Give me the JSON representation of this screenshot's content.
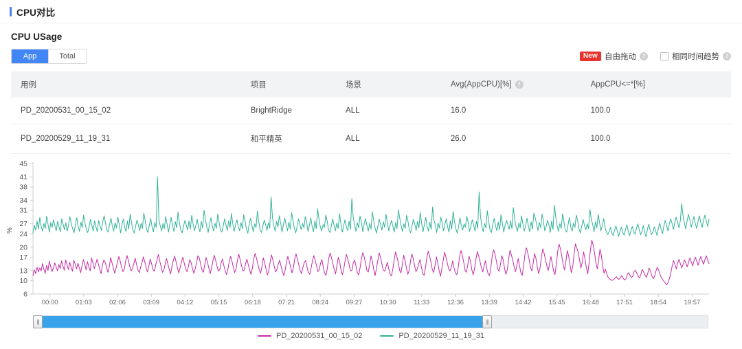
{
  "panel": {
    "title": "CPU对比"
  },
  "section": {
    "title": "CPU USage"
  },
  "tabs": [
    {
      "label": "App",
      "active": true
    },
    {
      "label": "Total",
      "active": false
    }
  ],
  "toolbar": {
    "new_badge": "New",
    "free_drag_label": "自由拖动",
    "free_drag_help": "?",
    "same_time_trend_label": "相同时间趋势",
    "same_time_trend_help": "?",
    "same_time_trend_checked": false
  },
  "table": {
    "columns": [
      "用例",
      "项目",
      "场景",
      "Avg(AppCPU)[%]",
      "AppCPU<=*[%]"
    ],
    "column_help": [
      false,
      false,
      false,
      true,
      false
    ],
    "rows": [
      {
        "case": "PD_20200531_00_15_02",
        "project": "BrightRidge",
        "scene": "ALL",
        "avg_app_cpu": "16.0",
        "app_cpu_le": "100.0"
      },
      {
        "case": "PD_20200529_11_19_31",
        "project": "和平精英",
        "scene": "ALL",
        "avg_app_cpu": "26.0",
        "app_cpu_le": "100.0"
      }
    ]
  },
  "legend": [
    {
      "label": "PD_20200531_00_15_02",
      "color": "#c62ba4"
    },
    {
      "label": "PD_20200529_11_19_31",
      "color": "#30b298"
    }
  ],
  "range_slider": {
    "left_handle": "|||",
    "right_handle": "|||",
    "start_pct": 0,
    "end_pct": 67
  },
  "colors": {
    "accent": "#4285f4",
    "badge_red": "#e8322b",
    "slider_blue": "#38a3ea",
    "series_magenta": "#c62ba4",
    "series_teal": "#30b298",
    "header_bg": "#f2f3f5"
  },
  "chart_data": {
    "type": "line",
    "title": "",
    "xlabel": "",
    "ylabel": "%",
    "ylim": [
      6,
      45
    ],
    "yticks": [
      45,
      41,
      38,
      34,
      31,
      27,
      24,
      20,
      17,
      13,
      10,
      6
    ],
    "xticks": [
      "00:00",
      "01:03",
      "02:06",
      "03:09",
      "04:12",
      "05:15",
      "06:18",
      "07:21",
      "08:24",
      "09:27",
      "10:30",
      "11:33",
      "12:36",
      "13:39",
      "14:42",
      "15:45",
      "16:48",
      "17:51",
      "18:54",
      "19:57"
    ],
    "grid": false,
    "legend_position": "bottom",
    "series": [
      {
        "name": "PD_20200531_00_15_02",
        "color": "#c62ba4",
        "mean": 16.0,
        "values": [
          11.5,
          13.2,
          12.1,
          14.0,
          12.6,
          13.8,
          12.9,
          15.1,
          13.4,
          12.2,
          14.6,
          13.0,
          15.8,
          14.2,
          12.7,
          13.9,
          15.3,
          14.1,
          12.9,
          14.8,
          13.6,
          15.9,
          14.3,
          13.1,
          16.2,
          14.7,
          13.3,
          15.5,
          14.0,
          12.8,
          16.1,
          14.9,
          13.5,
          15.2,
          13.8,
          12.4,
          14.5,
          16.3,
          14.8,
          13.2,
          15.7,
          14.1,
          12.9,
          16.8,
          15.2,
          13.6,
          14.9,
          16.4,
          15.0,
          13.3,
          12.1,
          14.7,
          16.2,
          15.5,
          13.9,
          12.5,
          14.2,
          16.9,
          15.3,
          13.7,
          12.2,
          13.8,
          15.6,
          17.2,
          15.8,
          14.1,
          12.7,
          13.4,
          15.9,
          17.5,
          16.0,
          14.3,
          12.9,
          13.6,
          15.1,
          16.7,
          14.8,
          13.2,
          12.4,
          14.0,
          15.4,
          17.1,
          15.7,
          13.9,
          12.6,
          14.3,
          16.5,
          15.1,
          13.4,
          12.8,
          14.6,
          16.2,
          17.8,
          15.9,
          14.2,
          12.5,
          13.1,
          15.0,
          16.6,
          14.9,
          13.3,
          12.0,
          14.4,
          16.1,
          17.3,
          15.6,
          13.8,
          12.3,
          13.9,
          15.8,
          17.0,
          15.2,
          13.5,
          12.7,
          14.1,
          16.3,
          15.4,
          13.7,
          12.2,
          13.5,
          15.3,
          17.4,
          16.8,
          15.0,
          13.2,
          12.5,
          14.7,
          16.9,
          15.5,
          13.8,
          12.1,
          13.7,
          15.9,
          17.6,
          16.1,
          14.4,
          12.8,
          13.3,
          15.2,
          16.5,
          14.6,
          13.0,
          11.8,
          13.4,
          15.7,
          17.2,
          15.8,
          14.0,
          12.4,
          13.6,
          16.0,
          17.9,
          16.3,
          14.5,
          12.9,
          13.2,
          15.1,
          16.4,
          14.7,
          13.1,
          11.9,
          13.8,
          16.6,
          18.1,
          16.7,
          14.9,
          13.3,
          12.2,
          14.2,
          16.8,
          15.3,
          13.5,
          11.7,
          13.0,
          15.5,
          17.7,
          16.2,
          14.3,
          12.6,
          13.4,
          15.0,
          16.1,
          14.4,
          12.8,
          11.5,
          13.1,
          15.6,
          17.3,
          15.9,
          14.1,
          12.3,
          13.7,
          16.4,
          18.0,
          16.5,
          14.8,
          13.0,
          12.1,
          13.9,
          15.4,
          16.0,
          14.2,
          12.5,
          11.9,
          13.6,
          15.8,
          17.5,
          16.1,
          14.6,
          12.7,
          13.3,
          15.2,
          16.3,
          14.0,
          12.2,
          11.6,
          13.8,
          16.7,
          18.2,
          16.9,
          15.1,
          13.4,
          12.0,
          14.5,
          17.0,
          15.6,
          13.2,
          11.8,
          13.5,
          15.9,
          17.8,
          16.4,
          14.7,
          12.9,
          13.1,
          15.3,
          16.2,
          14.3,
          12.4,
          11.7,
          13.9,
          16.6,
          18.4,
          17.1,
          15.2,
          13.0,
          12.6,
          14.8,
          17.4,
          15.7,
          13.3,
          11.5,
          13.7,
          16.0,
          18.3,
          16.8,
          15.0,
          13.2,
          12.8,
          14.1,
          15.5,
          13.6,
          12.0,
          11.4,
          13.4,
          16.2,
          18.6,
          17.2,
          15.4,
          13.1,
          12.3,
          14.9,
          17.6,
          16.0,
          13.8,
          11.9,
          13.0,
          15.8,
          18.0,
          16.6,
          14.4,
          12.7,
          13.5,
          15.1,
          16.3,
          14.0,
          12.1,
          11.6,
          13.9,
          16.9,
          18.8,
          17.3,
          15.5,
          13.3,
          12.4,
          14.6,
          17.1,
          15.2,
          13.0,
          11.3,
          13.6,
          16.1,
          18.5,
          17.0,
          15.3,
          13.4,
          12.9,
          14.2,
          15.9,
          13.7,
          12.2,
          11.8,
          14.0,
          17.2,
          19.0,
          17.5,
          15.6,
          13.1,
          12.5,
          14.7,
          17.3,
          15.8,
          13.2,
          11.7,
          13.8,
          16.4,
          18.7,
          17.4,
          15.7,
          13.9,
          12.6,
          14.3,
          16.0,
          13.5,
          12.0,
          11.5,
          14.1,
          17.6,
          19.2,
          17.8,
          15.9,
          13.4,
          12.8,
          14.9,
          17.5,
          16.2,
          13.6,
          11.9,
          13.3,
          16.5,
          19.1,
          17.7,
          16.1,
          14.2,
          12.7,
          14.5,
          16.6,
          14.4,
          12.3,
          11.6,
          14.6,
          18.0,
          19.8,
          18.3,
          16.4,
          14.0,
          12.9,
          15.2,
          18.1,
          16.7,
          14.1,
          12.1,
          13.7,
          17.0,
          19.5,
          18.2,
          16.3,
          14.5,
          13.0,
          15.0,
          17.2,
          15.1,
          12.8,
          11.8,
          15.0,
          18.8,
          20.9,
          19.5,
          17.3,
          14.8,
          13.2,
          15.8,
          19.0,
          17.4,
          14.7,
          12.4,
          14.2,
          17.9,
          21.0,
          19.8,
          18.5,
          16.2,
          13.8,
          15.5,
          18.6,
          16.5,
          13.9,
          12.0,
          15.3,
          19.2,
          22.1,
          20.6,
          18.4,
          15.4,
          13.5,
          16.1,
          19.4,
          17.6,
          14.3,
          12.2,
          13.4,
          12.0,
          11.0,
          10.5,
          10.2,
          10.1,
          10.3,
          10.8,
          11.2,
          10.6,
          10.4,
          10.9,
          11.5,
          10.7,
          10.2,
          10.5,
          11.8,
          12.4,
          11.6,
          10.9,
          11.3,
          12.7,
          13.1,
          12.2,
          11.4,
          10.8,
          11.9,
          13.4,
          12.6,
          11.7,
          11.0,
          12.1,
          13.8,
          12.9,
          11.5,
          10.6,
          11.2,
          12.8,
          14.0,
          13.2,
          12.0,
          10.9,
          10.3,
          9.8,
          9.2,
          8.8,
          9.5,
          10.7,
          12.3,
          14.5,
          16.0,
          14.8,
          13.5,
          15.2,
          16.4,
          15.0,
          13.8,
          14.9,
          16.2,
          15.3,
          14.1,
          15.5,
          16.8,
          15.6,
          14.4,
          15.9,
          17.0,
          15.8,
          14.6,
          16.1,
          17.2,
          16.0,
          14.9,
          16.3,
          17.4,
          16.2,
          15.1
        ]
      },
      {
        "name": "PD_20200529_11_19_31",
        "color": "#30b298",
        "mean": 26.0,
        "values": [
          24.2,
          26.5,
          25.1,
          27.8,
          25.4,
          28.9,
          26.2,
          24.8,
          27.1,
          25.6,
          29.3,
          26.8,
          24.5,
          27.4,
          25.9,
          28.2,
          26.4,
          24.9,
          27.7,
          26.1,
          24.6,
          28.5,
          26.9,
          25.2,
          27.3,
          24.8,
          26.6,
          29.1,
          27.0,
          25.5,
          24.3,
          26.7,
          28.8,
          26.3,
          24.7,
          27.5,
          25.8,
          29.6,
          27.2,
          25.3,
          24.4,
          26.0,
          28.3,
          26.5,
          24.9,
          27.9,
          26.1,
          24.6,
          28.0,
          26.4,
          25.0,
          27.6,
          29.4,
          27.1,
          25.2,
          24.5,
          26.8,
          28.7,
          26.2,
          24.8,
          27.3,
          25.7,
          29.0,
          26.9,
          24.3,
          26.6,
          28.4,
          26.0,
          24.7,
          27.8,
          25.4,
          29.8,
          27.5,
          25.1,
          24.2,
          26.3,
          28.1,
          26.7,
          24.9,
          27.2,
          25.6,
          30.2,
          27.9,
          25.3,
          24.4,
          26.5,
          28.6,
          26.1,
          24.6,
          27.4,
          25.9,
          41.0,
          28.2,
          26.4,
          24.8,
          27.1,
          25.5,
          29.2,
          26.8,
          24.5,
          26.9,
          28.9,
          26.3,
          24.7,
          27.6,
          25.8,
          30.5,
          27.3,
          25.0,
          24.3,
          26.2,
          28.0,
          26.6,
          25.1,
          27.8,
          25.4,
          29.5,
          27.0,
          24.9,
          26.5,
          28.3,
          26.0,
          24.6,
          27.7,
          25.7,
          31.0,
          28.4,
          26.1,
          24.4,
          26.8,
          28.8,
          26.4,
          24.8,
          27.2,
          25.6,
          29.9,
          27.5,
          25.2,
          24.5,
          26.3,
          28.5,
          26.7,
          25.0,
          27.9,
          25.8,
          30.1,
          27.1,
          24.7,
          26.6,
          28.2,
          26.2,
          24.9,
          27.4,
          25.5,
          29.7,
          27.8,
          25.3,
          24.2,
          26.9,
          28.6,
          26.5,
          24.6,
          27.0,
          25.9,
          30.8,
          27.6,
          25.1,
          24.4,
          26.4,
          28.1,
          26.8,
          25.0,
          27.3,
          25.7,
          35.0,
          28.9,
          26.3,
          24.8,
          27.7,
          26.0,
          29.4,
          27.2,
          24.5,
          26.7,
          28.7,
          26.6,
          24.9,
          27.5,
          25.4,
          30.3,
          28.0,
          25.6,
          24.3,
          26.1,
          28.4,
          26.9,
          25.2,
          27.1,
          25.8,
          29.1,
          27.4,
          24.7,
          26.5,
          28.8,
          26.2,
          24.6,
          27.9,
          25.5,
          31.5,
          28.3,
          26.0,
          24.8,
          26.8,
          25.9,
          29.6,
          27.7,
          25.1,
          24.4,
          26.3,
          28.5,
          26.6,
          24.9,
          27.2,
          25.6,
          30.0,
          27.0,
          24.5,
          26.4,
          28.2,
          26.1,
          25.0,
          27.8,
          25.3,
          34.5,
          29.0,
          26.7,
          24.7,
          27.3,
          25.8,
          29.3,
          27.5,
          24.6,
          26.9,
          28.6,
          26.5,
          24.8,
          27.1,
          25.4,
          30.6,
          27.9,
          25.7,
          24.2,
          26.2,
          28.4,
          26.8,
          25.1,
          27.6,
          25.9,
          29.8,
          27.2,
          24.9,
          26.6,
          28.0,
          26.3,
          24.5,
          27.4,
          25.5,
          31.2,
          28.7,
          26.4,
          24.7,
          27.0,
          25.6,
          29.5,
          27.8,
          25.2,
          24.3,
          26.5,
          28.3,
          26.9,
          25.0,
          27.7,
          25.8,
          30.4,
          27.1,
          24.6,
          26.7,
          28.9,
          26.2,
          24.8,
          27.5,
          25.3,
          32.0,
          28.1,
          26.6,
          24.4,
          27.2,
          25.7,
          29.0,
          27.3,
          24.9,
          26.8,
          28.5,
          26.0,
          24.5,
          27.9,
          25.4,
          30.7,
          27.6,
          25.5,
          24.2,
          26.1,
          28.8,
          26.5,
          25.1,
          27.0,
          25.9,
          29.2,
          27.4,
          24.7,
          26.3,
          28.2,
          26.7,
          24.8,
          27.7,
          25.6,
          36.5,
          29.3,
          26.2,
          24.6,
          27.1,
          25.8,
          30.9,
          27.8,
          25.0,
          24.4,
          26.9,
          28.6,
          26.4,
          24.9,
          27.5,
          25.2,
          29.7,
          27.2,
          24.5,
          26.6,
          28.0,
          26.8,
          25.3,
          27.9,
          25.5,
          31.8,
          28.4,
          26.1,
          24.7,
          27.3,
          25.7,
          29.4,
          27.0,
          24.8,
          26.5,
          28.7,
          26.3,
          24.6,
          27.6,
          25.4,
          30.2,
          28.8,
          26.9,
          25.0,
          27.4,
          25.8,
          29.9,
          27.7,
          24.9,
          26.2,
          28.1,
          26.6,
          24.4,
          27.8,
          25.3,
          32.5,
          29.1,
          26.4,
          24.7,
          27.1,
          25.6,
          30.0,
          27.5,
          25.1,
          24.5,
          26.7,
          28.9,
          26.0,
          24.8,
          27.2,
          25.9,
          29.6,
          27.9,
          25.4,
          24.3,
          26.3,
          28.3,
          26.5,
          25.2,
          27.0,
          25.5,
          31.3,
          28.2,
          26.8,
          24.6,
          27.6,
          25.7,
          29.8,
          27.4,
          24.9,
          26.4,
          28.5,
          26.1,
          24.5,
          23.8,
          24.6,
          25.9,
          24.2,
          23.5,
          25.1,
          26.4,
          24.8,
          23.2,
          24.9,
          26.0,
          24.4,
          23.6,
          25.3,
          26.7,
          24.7,
          23.4,
          25.0,
          26.2,
          24.5,
          23.9,
          25.6,
          27.0,
          25.2,
          23.7,
          24.8,
          26.5,
          24.3,
          23.1,
          25.4,
          26.9,
          25.0,
          23.8,
          24.6,
          26.1,
          24.9,
          23.5,
          25.7,
          27.2,
          25.5,
          24.0,
          26.3,
          28.0,
          26.6,
          24.8,
          26.9,
          28.5,
          27.1,
          25.3,
          27.4,
          29.0,
          27.6,
          25.8,
          27.8,
          33.0,
          29.5,
          27.2,
          25.5,
          27.9,
          29.8,
          28.1,
          26.0,
          27.5,
          29.2,
          27.0,
          25.6,
          27.7,
          29.4,
          27.3,
          25.9,
          28.0,
          29.6,
          27.8,
          26.2,
          28.4
        ]
      }
    ]
  }
}
